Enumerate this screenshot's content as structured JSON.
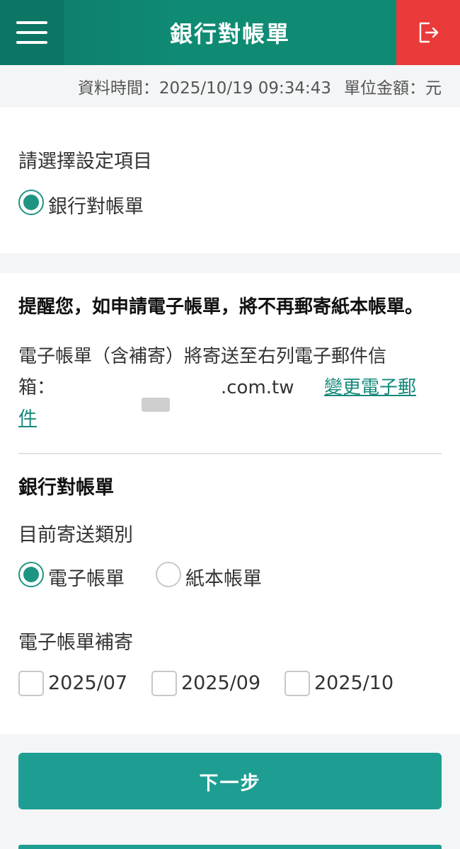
{
  "header": {
    "title": "銀行對帳單"
  },
  "info": {
    "data_time": "資料時間：2025/10/19 09:34:43",
    "unit": "單位金額：元"
  },
  "setting": {
    "label": "請選擇設定項目",
    "option": "銀行對帳單",
    "selected": true
  },
  "notice": {
    "bold": "提醒您，如申請電子帳單，將不再郵寄紙本帳單。",
    "line1": "電子帳單（含補寄）將寄送至右列電子郵件信",
    "line2_prefix": "箱：",
    "email_suffix": ".com.tw",
    "change_link_part1": "變更電子郵",
    "change_link_part2": "件"
  },
  "statement": {
    "title": "銀行對帳單",
    "delivery_label": "目前寄送類別",
    "options": [
      {
        "label": "電子帳單",
        "selected": true
      },
      {
        "label": "紙本帳單",
        "selected": false
      }
    ],
    "resend_label": "電子帳單補寄",
    "months": [
      "2025/07",
      "2025/09",
      "2025/10"
    ]
  },
  "actions": {
    "next": "下一步"
  }
}
